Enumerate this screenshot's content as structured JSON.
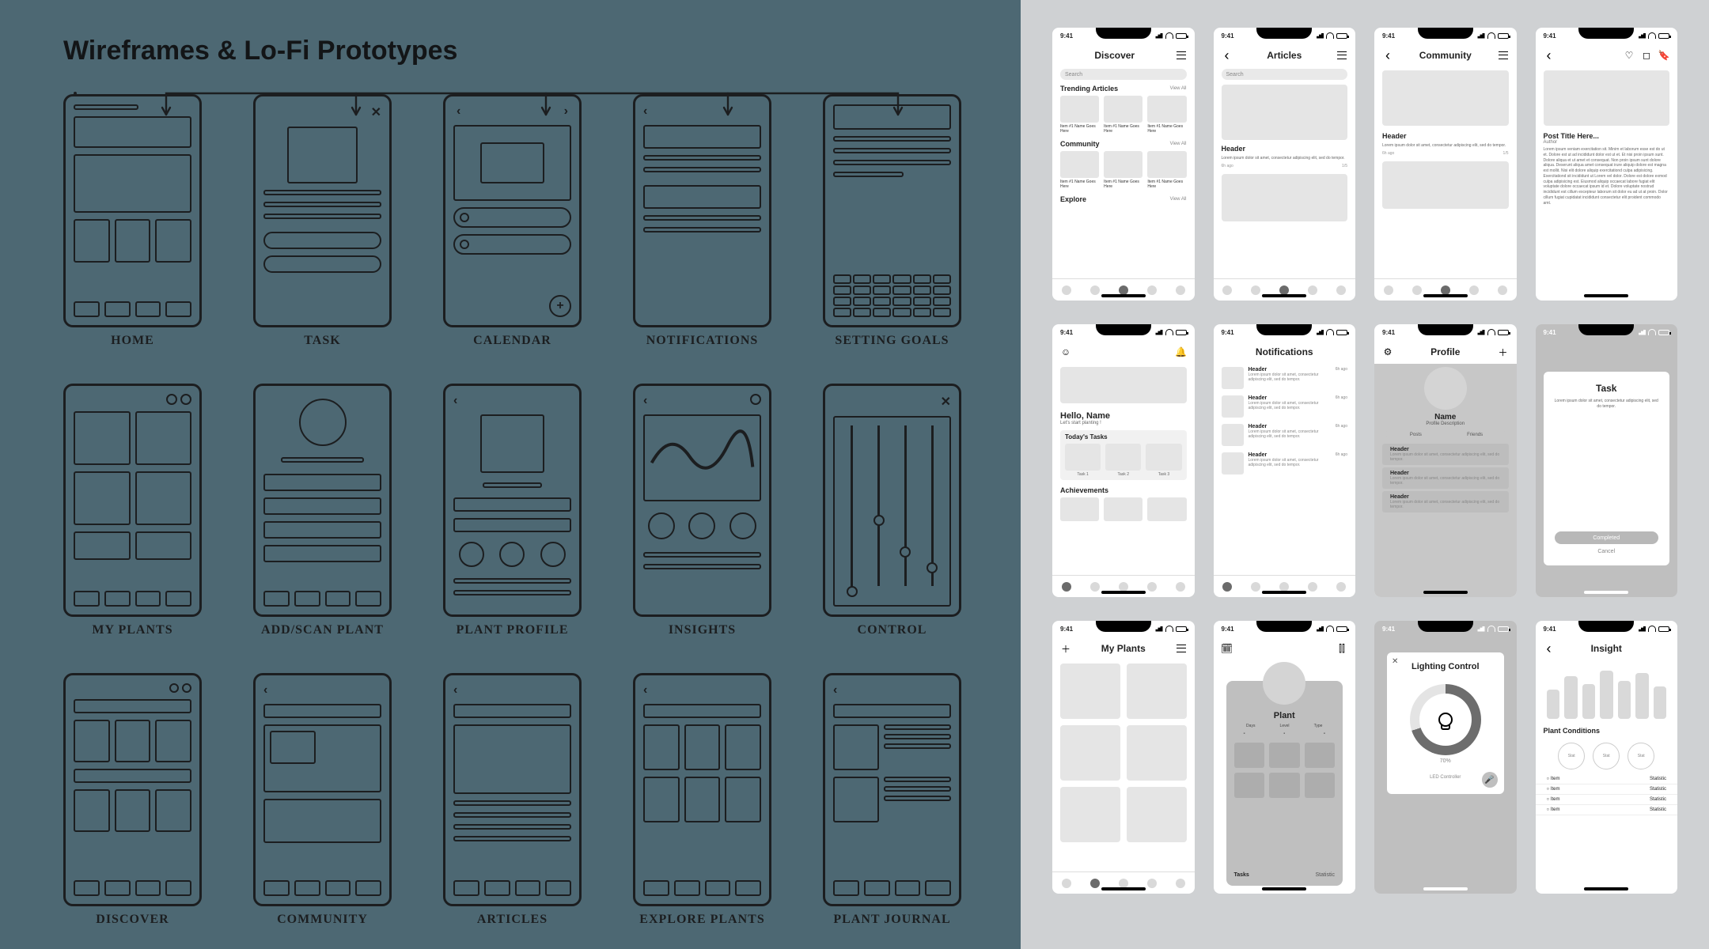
{
  "page": {
    "title": "Wireframes & Lo-Fi Prototypes"
  },
  "sketch_labels": [
    "HOME",
    "TASK",
    "CALENDAR",
    "NOTIFICATIONS",
    "SETTING GOALS",
    "MY PLANTS",
    "ADD/SCAN PLANT",
    "PLANT PROFILE",
    "INSIGHTS",
    "CONTROL",
    "DISCOVER",
    "COMMUNITY",
    "ARTICLES",
    "EXPLORE PLANTS",
    "PLANT JOURNAL"
  ],
  "status_time": "9:41",
  "search_placeholder": "Search",
  "view_all": "View All",
  "pager": "1/5",
  "lorem_short": "Lorem ipsum dolor sit amet, consectetur adipiscing elit, sed do tempor.",
  "lorem_long": "Lorem ipsum veniam exercitation sit. Minim et laborum esse est do ut et. Dolore est ut ad incididunt dolor est ut et. Et nisi proin ipsum sunt. Dolore aliqua et ut amet et consequat. Non proin ipsum sunt dolore aliqua. Deserunt aliqua amet consequat irure aliquip dolore est magna est mollit. Nisi elit dolore aliquip exercitationd culpa adipisicing. Exercitationd sit incididunt ut Lorem vel dolor. Dolore est dolore exmod culpa adipisicing est. Eiusmod aliquip occaecat labore fugiat elit voluptate dolore occaecat ipsum id et. Dolore voluptate nostrud incididunt est cillum excepteur laborum sit dolor eu ad ut at proin. Dolor cillum fugiat cupidatat incididunt consectetur elit proident commodo amt.",
  "item_label": "Item #1 Name Goes Here",
  "time_ago": "6h ago",
  "header_label": "Header",
  "screens": {
    "discover": {
      "title": "Discover",
      "sections": [
        "Trending Articles",
        "Community",
        "Explore"
      ]
    },
    "articles": {
      "title": "Articles"
    },
    "community": {
      "title": "Community"
    },
    "post": {
      "title": "Post Title Here...",
      "author": "Author"
    },
    "home": {
      "hello": "Hello, Name",
      "sub": "Let's start planting !",
      "sections": [
        "Today's Tasks",
        "Achievements"
      ],
      "tasks": [
        "Task 1",
        "Task 2",
        "Task 3"
      ]
    },
    "notifications": {
      "title": "Notifications"
    },
    "profile": {
      "title": "Profile",
      "name": "Name",
      "desc": "Profile Description",
      "tabs": [
        "Posts",
        "Friends"
      ]
    },
    "task": {
      "title": "Task",
      "primary": "Completed",
      "secondary": "Cancel"
    },
    "myplants": {
      "title": "My Plants"
    },
    "plant": {
      "title": "Plant",
      "fields": [
        "Days",
        "Level",
        "Type"
      ],
      "tasks_label": "Tasks",
      "stat_label": "Statistic"
    },
    "lighting": {
      "title": "Lighting Control",
      "pct": "70%",
      "caption": "LED Controller"
    },
    "insight": {
      "title": "Insight",
      "section": "Plant Conditions",
      "stat_col": "Statistic",
      "item_col": "Item",
      "stat_val": "Stat"
    }
  }
}
